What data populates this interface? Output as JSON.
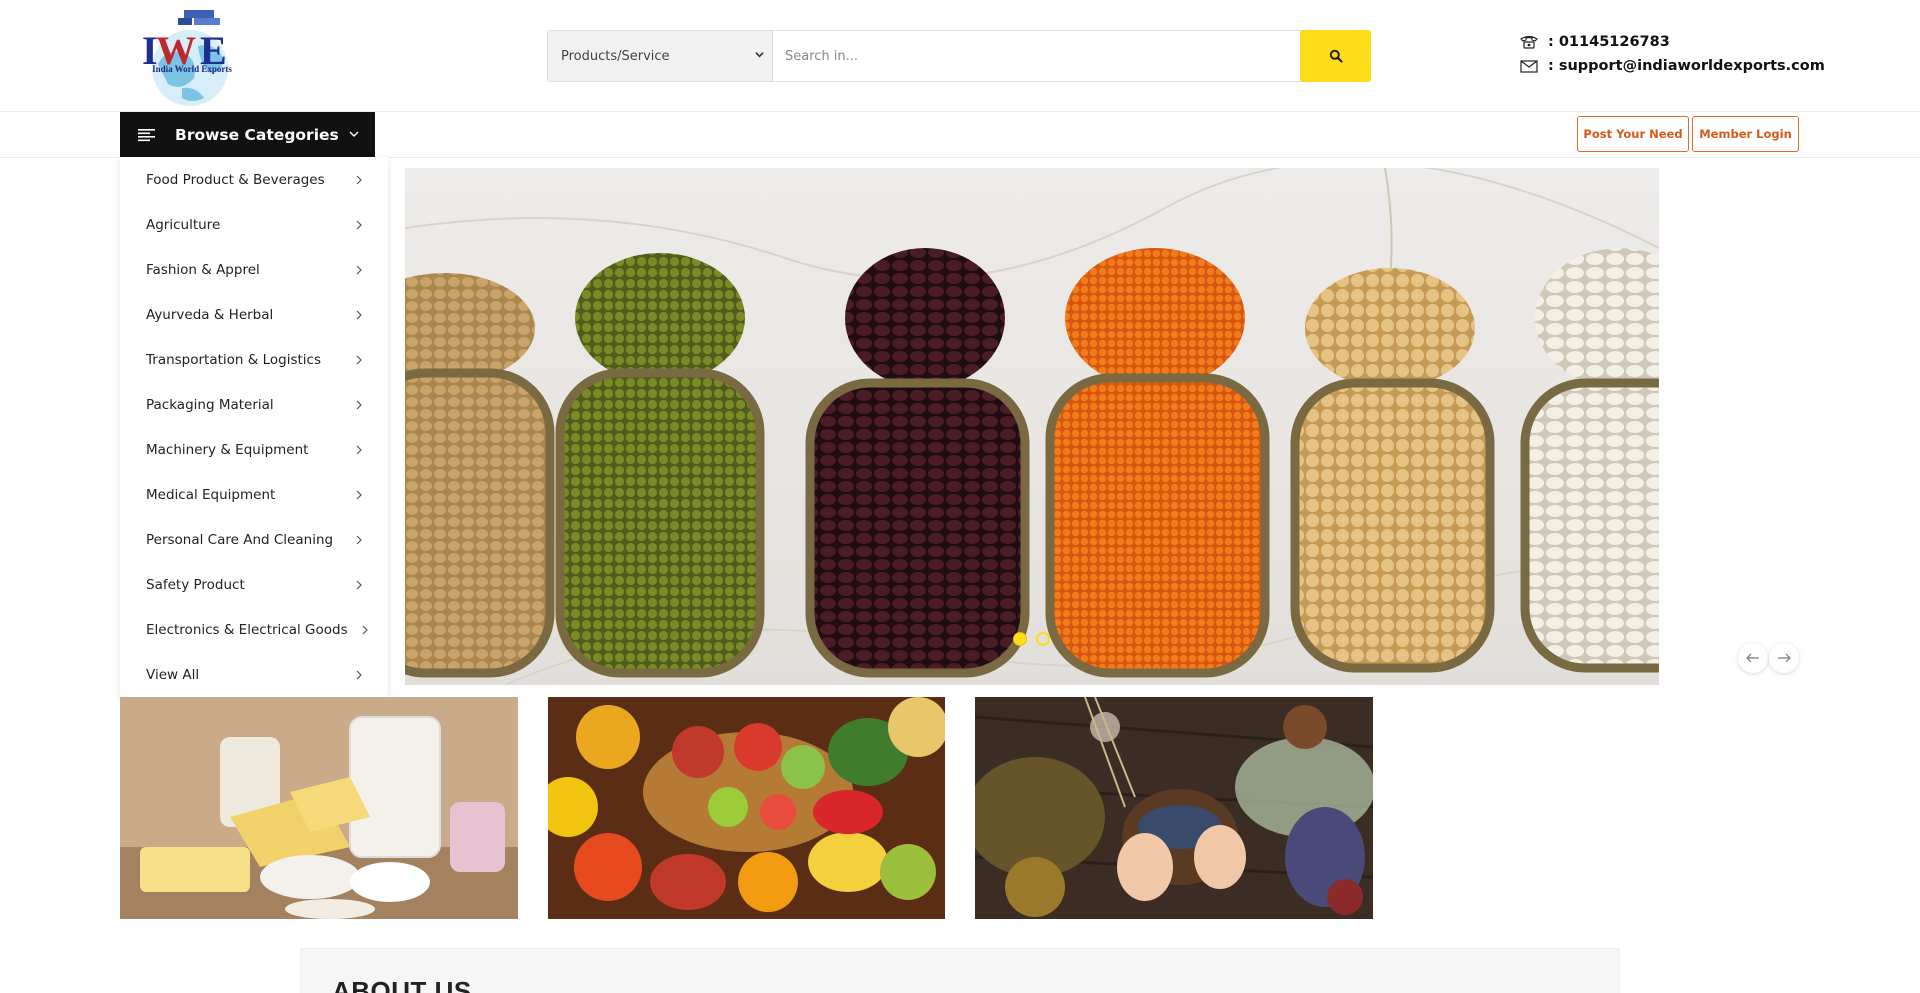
{
  "header": {
    "logo_text": "India World Exports",
    "search": {
      "category_selected": "Products/Service",
      "placeholder": "Search in..."
    },
    "contact": {
      "phone": ": 01145126783",
      "email": ": support@indiaworldexports.com"
    }
  },
  "nav": {
    "browse_label": "Browse Categories",
    "post_need_label": "Post Your Need",
    "member_login_label": "Member Login"
  },
  "categories": [
    "Food Product & Beverages",
    "Agriculture",
    "Fashion & Apprel",
    "Ayurveda & Herbal",
    "Transportation & Logistics",
    "Packaging Material",
    "Machinery & Equipment",
    "Medical Equipment",
    "Personal Care And Cleaning",
    "Safety Product",
    "Electronics & Electrical Goods",
    "View All"
  ],
  "slider": {
    "active_slide": 1,
    "slide_count": 2
  },
  "about": {
    "title": "ABOUT US"
  },
  "colors": {
    "accent_yellow": "#fedc19",
    "button_orange": "#d45a1a",
    "browse_bg": "#111111"
  }
}
